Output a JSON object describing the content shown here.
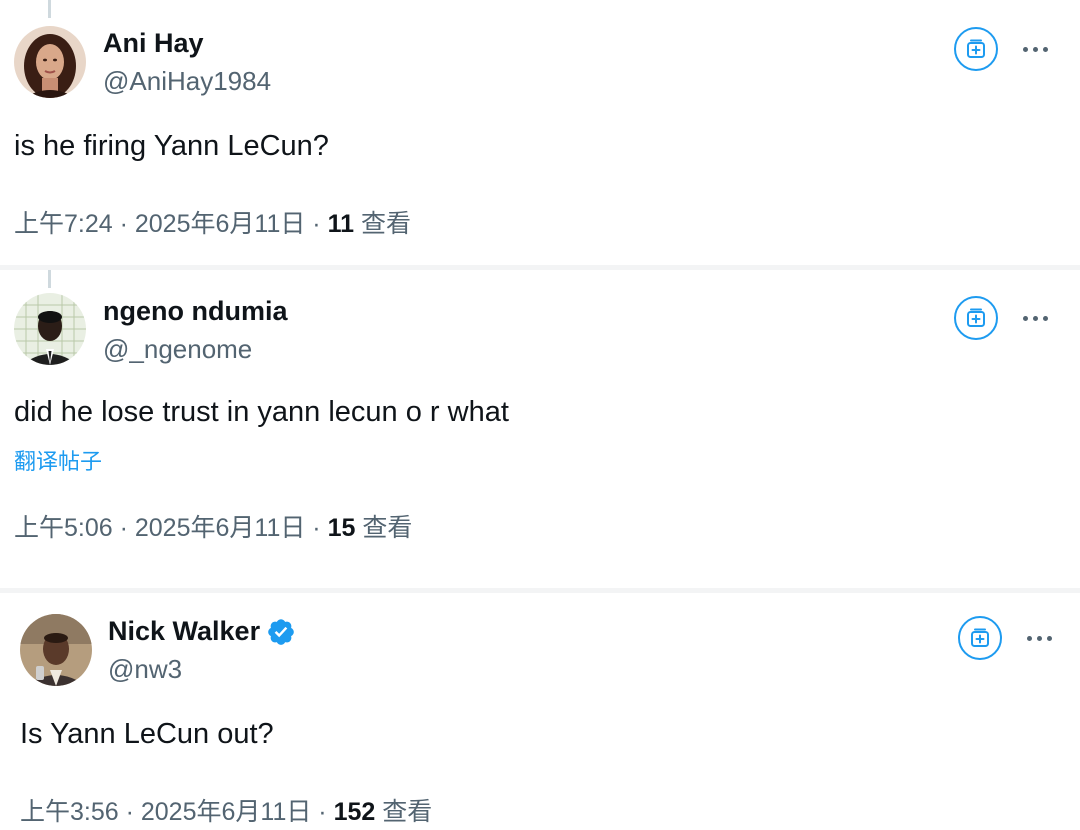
{
  "posts": [
    {
      "name": "Ani Hay",
      "handle": "@AniHay1984",
      "text": "is he firing Yann LeCun?",
      "translate_label": "",
      "time": "上午7:24 · 2025年6月11日 · ",
      "views_count": "11",
      "views_label": " 查看",
      "verified": false
    },
    {
      "name": "ngeno ndumia",
      "handle": "@_ngenome",
      "text": "did he lose trust in yann lecun o r what",
      "translate_label": "翻译帖子",
      "time": "上午5:06 · 2025年6月11日 · ",
      "views_count": "15",
      "views_label": " 查看",
      "verified": false
    },
    {
      "name": "Nick Walker",
      "handle": "@nw3",
      "text": "Is Yann LeCun out?",
      "translate_label": "",
      "time": "上午3:56 · 2025年6月11日 · ",
      "views_count": "152",
      "views_label": " 查看",
      "verified": true
    }
  ],
  "icons": {
    "grok": "grok-bookmark-icon",
    "more": "more-horizontal-icon",
    "verified": "verified-badge-icon"
  },
  "colors": {
    "accent": "#1d9bf0",
    "text_primary": "#0f1419",
    "text_secondary": "#536471",
    "verified": "#1d9bf0"
  }
}
